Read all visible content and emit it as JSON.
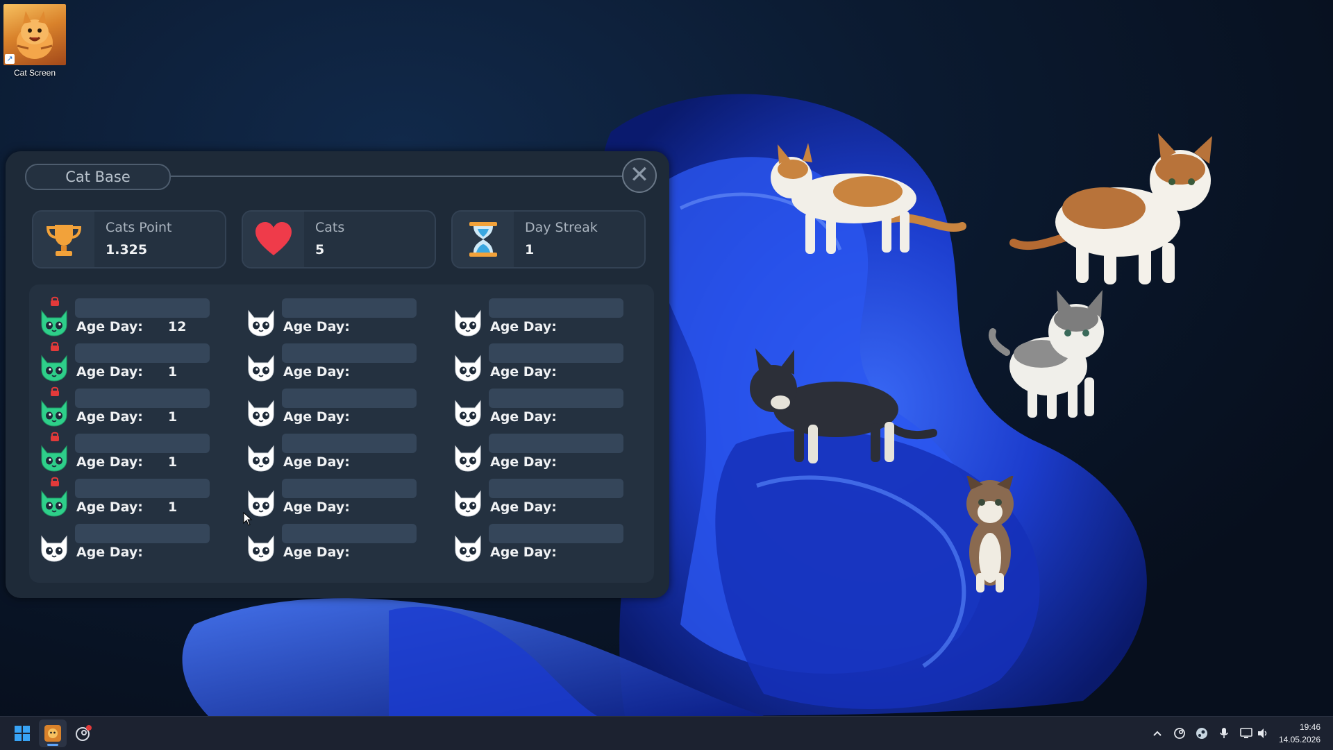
{
  "desktop": {
    "shortcut_label": "Cat Screen"
  },
  "window": {
    "title": "Cat Base",
    "close_glyph": "✕"
  },
  "stats": [
    {
      "label": "Cats Point",
      "value": "1.325",
      "icon": "trophy-icon"
    },
    {
      "label": "Cats",
      "value": "5",
      "icon": "heart-icon"
    },
    {
      "label": "Day Streak",
      "value": "1",
      "icon": "hourglass-icon"
    }
  ],
  "colors": {
    "owned_cat": "#2ecf8a",
    "empty_cat": "#ffffff",
    "lock": "#e23a3a",
    "heart": "#ef3b4a",
    "trophy": "#f2a23a",
    "hourglass": "#3aa7e0"
  },
  "age_label": "Age Day:",
  "cat_grid": {
    "columns": [
      [
        {
          "owned": true,
          "locked": true,
          "age": "12"
        },
        {
          "owned": true,
          "locked": true,
          "age": "1"
        },
        {
          "owned": true,
          "locked": true,
          "age": "1"
        },
        {
          "owned": true,
          "locked": true,
          "age": "1"
        },
        {
          "owned": true,
          "locked": true,
          "age": "1"
        },
        {
          "owned": false,
          "locked": false,
          "age": ""
        }
      ],
      [
        {
          "owned": false,
          "locked": false,
          "age": ""
        },
        {
          "owned": false,
          "locked": false,
          "age": ""
        },
        {
          "owned": false,
          "locked": false,
          "age": ""
        },
        {
          "owned": false,
          "locked": false,
          "age": ""
        },
        {
          "owned": false,
          "locked": false,
          "age": ""
        },
        {
          "owned": false,
          "locked": false,
          "age": ""
        }
      ],
      [
        {
          "owned": false,
          "locked": false,
          "age": ""
        },
        {
          "owned": false,
          "locked": false,
          "age": ""
        },
        {
          "owned": false,
          "locked": false,
          "age": ""
        },
        {
          "owned": false,
          "locked": false,
          "age": ""
        },
        {
          "owned": false,
          "locked": false,
          "age": ""
        },
        {
          "owned": false,
          "locked": false,
          "age": ""
        }
      ]
    ]
  },
  "taskbar": {
    "time": "19:46",
    "date": "14.05.2026",
    "tray_icons": [
      "chevron-up-icon",
      "steam-like-icon",
      "steam-icon",
      "microphone-icon",
      "network-icon",
      "volume-icon"
    ]
  }
}
